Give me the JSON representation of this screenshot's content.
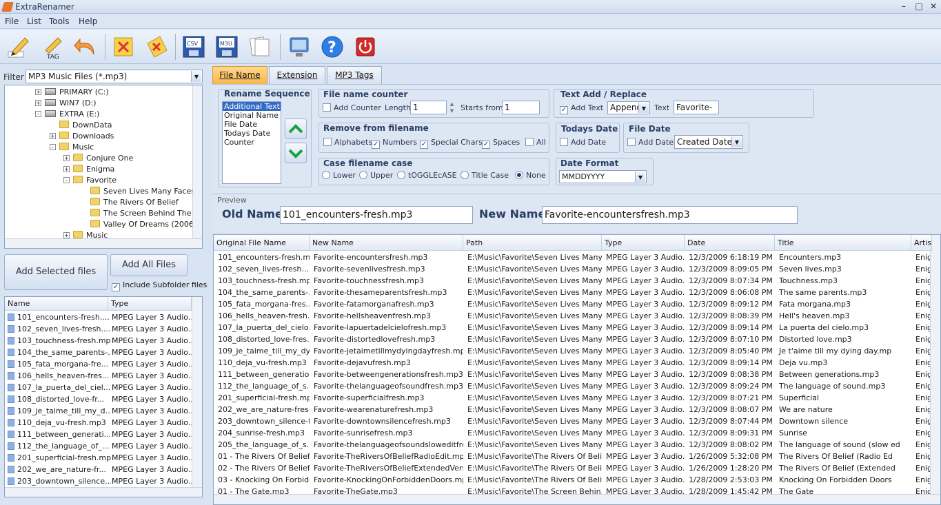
{
  "window": {
    "title": "ExtraRenamer"
  },
  "menu": [
    "File",
    "List",
    "Tools",
    "Help"
  ],
  "toolbar_icons": [
    "rename-pencil-icon",
    "tag-rename-icon",
    "undo-arrow-icon",
    "clear-selection-icon",
    "clear-all-icon",
    "csv-export-icon",
    "m3u-export-icon",
    "copy-pages-icon",
    "network-computer-icon",
    "help-icon",
    "power-icon"
  ],
  "toolbar_labels": {
    "csv": "CSV",
    "m3u": "M3U",
    "tag": "TAG"
  },
  "filter": {
    "label": "Filter",
    "value": "MP3 Music Files (*.mp3)"
  },
  "tree": [
    {
      "label": "PRIMARY (C:)",
      "indent": 0,
      "type": "drive",
      "pm": "+"
    },
    {
      "label": "WIN7 (D:)",
      "indent": 0,
      "type": "drive",
      "pm": "+"
    },
    {
      "label": "EXTRA (E:)",
      "indent": 0,
      "type": "drive",
      "pm": "-"
    },
    {
      "label": "DownData",
      "indent": 1,
      "type": "folder",
      "pm": ""
    },
    {
      "label": "Downloads",
      "indent": 1,
      "type": "folder",
      "pm": "+"
    },
    {
      "label": "Music",
      "indent": 1,
      "type": "folder",
      "pm": "-"
    },
    {
      "label": "Conjure One",
      "indent": 2,
      "type": "folder",
      "pm": "+"
    },
    {
      "label": "Enigma",
      "indent": 2,
      "type": "folder",
      "pm": "+"
    },
    {
      "label": "Favorite",
      "indent": 2,
      "type": "folder",
      "pm": "-"
    },
    {
      "label": "Seven Lives Many Faces",
      "indent": 3,
      "type": "folder",
      "pm": ""
    },
    {
      "label": "The Rivers Of Belief",
      "indent": 3,
      "type": "folder",
      "pm": ""
    },
    {
      "label": "The Screen Behind The Mirr",
      "indent": 3,
      "type": "folder",
      "pm": ""
    },
    {
      "label": "Valley Of Dreams (2006)",
      "indent": 3,
      "type": "folder",
      "pm": ""
    },
    {
      "label": "Music",
      "indent": 2,
      "type": "folder",
      "pm": "+"
    }
  ],
  "buttons": {
    "add_selected": "Add Selected files",
    "add_all": "Add All Files",
    "include_subfolder": "Include Subfolder files"
  },
  "filelist": {
    "headers": [
      "Name",
      "Type"
    ],
    "rows": [
      [
        "101_encounters-fresh....",
        "MPEG Layer 3 Audio..."
      ],
      [
        "102_seven_lives-fresh....",
        "MPEG Layer 3 Audio..."
      ],
      [
        "103_touchness-fresh.mp3",
        "MPEG Layer 3 Audio..."
      ],
      [
        "104_the_same_parents-...",
        "MPEG Layer 3 Audio..."
      ],
      [
        "105_fata_morgana-fre...",
        "MPEG Layer 3 Audio..."
      ],
      [
        "106_hells_heaven-fres...",
        "MPEG Layer 3 Audio..."
      ],
      [
        "107_la_puerta_del_ciel...",
        "MPEG Layer 3 Audio..."
      ],
      [
        "108_distorted_love-fr...",
        "MPEG Layer 3 Audio..."
      ],
      [
        "109_je_taime_till_my_d...",
        "MPEG Layer 3 Audio..."
      ],
      [
        "110_deja_vu-fresh.mp3",
        "MPEG Layer 3 Audio..."
      ],
      [
        "111_between_generati...",
        "MPEG Layer 3 Audio..."
      ],
      [
        "112_the_language_of_...",
        "MPEG Layer 3 Audio..."
      ],
      [
        "201_superficial-fresh.mp3",
        "MPEG Layer 3 Audio..."
      ],
      [
        "202_we_are_nature-fr...",
        "MPEG Layer 3 Audio..."
      ],
      [
        "203_downtown_silence...",
        "MPEG Layer 3 Audio..."
      ]
    ]
  },
  "tabs": [
    "File Name",
    "Extension",
    "MP3 Tags"
  ],
  "rename_sequence": {
    "title": "Rename Sequence",
    "items": [
      "Additional Text",
      "Original Name",
      "File Date",
      "Todays Date",
      "Counter"
    ],
    "selected": 0
  },
  "counter": {
    "title": "File name counter",
    "add_label": "Add Counter",
    "length_label": "Length",
    "length_value": "1",
    "start_label": "Starts from",
    "start_value": "1"
  },
  "text_add": {
    "title": "Text Add / Replace",
    "add_label": "Add Text",
    "mode": "Append",
    "text_label": "Text",
    "text_value": "Favorite-"
  },
  "remove": {
    "title": "Remove from filename",
    "options": [
      {
        "label": "Alphabets",
        "checked": false
      },
      {
        "label": "Numbers",
        "checked": true
      },
      {
        "label": "Special Chars.",
        "checked": true
      },
      {
        "label": "Spaces",
        "checked": true
      },
      {
        "label": "All",
        "checked": false
      }
    ]
  },
  "todays_date": {
    "title": "Todays Date",
    "add_label": "Add Date"
  },
  "file_date": {
    "title": "File Date",
    "add_label": "Add Date",
    "mode": "Created Date"
  },
  "case": {
    "title": "Case filename case",
    "options": [
      "Lower",
      "Upper",
      "tOGGLEcASE",
      "Title Case",
      "None"
    ],
    "selected": 4
  },
  "date_format": {
    "title": "Date Format",
    "value": "MMDDYYYY"
  },
  "preview": {
    "title": "Preview",
    "old_label": "Old Name",
    "old_value": "101_encounters-fresh.mp3",
    "new_label": "New Name",
    "new_value": "Favorite-encountersfresh.mp3"
  },
  "grid": {
    "headers": [
      "Original File Name",
      "New Name",
      "Path",
      "Type",
      "Date",
      "Title",
      "Artis"
    ],
    "rows": [
      [
        "101_encounters-fresh.mp3",
        "Favorite-encountersfresh.mp3",
        "E:\\Music\\Favorite\\Seven Lives Many...",
        "MPEG Layer 3 Audio...",
        "12/3/2009 6:18:19 PM",
        "Encounters.mp3",
        "Enig"
      ],
      [
        "102_seven_lives-fresh....",
        "Favorite-sevenlivesfresh.mp3",
        "E:\\Music\\Favorite\\Seven Lives Many...",
        "MPEG Layer 3 Audio...",
        "12/3/2009 8:09:05 PM",
        "Seven lives.mp3",
        "Enig"
      ],
      [
        "103_touchness-fresh.mp3",
        "Favorite-touchnessfresh.mp3",
        "E:\\Music\\Favorite\\Seven Lives Many...",
        "MPEG Layer 3 Audio...",
        "12/3/2009 8:07:34 PM",
        "Touchness.mp3",
        "Enig"
      ],
      [
        "104_the_same_parents-...",
        "Favorite-thesameparentsfresh.mp3",
        "E:\\Music\\Favorite\\Seven Lives Many...",
        "MPEG Layer 3 Audio...",
        "12/3/2009 8:06:08 PM",
        "The same parents.mp3",
        "Enig"
      ],
      [
        "105_fata_morgana-fres...",
        "Favorite-fatamorganafresh.mp3",
        "E:\\Music\\Favorite\\Seven Lives Many...",
        "MPEG Layer 3 Audio...",
        "12/3/2009 8:09:12 PM",
        "Fata morgana.mp3",
        "Enig"
      ],
      [
        "106_hells_heaven-fresh...",
        "Favorite-hellsheavenfresh.mp3",
        "E:\\Music\\Favorite\\Seven Lives Many...",
        "MPEG Layer 3 Audio...",
        "12/3/2009 8:08:39 PM",
        "Hell's heaven.mp3",
        "Enig"
      ],
      [
        "107_la_puerta_del_cielo...",
        "Favorite-lapuertadelcielofresh.mp3",
        "E:\\Music\\Favorite\\Seven Lives Many...",
        "MPEG Layer 3 Audio...",
        "12/3/2009 8:09:14 PM",
        "La puerta del cielo.mp3",
        "Enig"
      ],
      [
        "108_distorted_love-fres...",
        "Favorite-distortedlovefresh.mp3",
        "E:\\Music\\Favorite\\Seven Lives Many...",
        "MPEG Layer 3 Audio...",
        "12/3/2009 8:07:10 PM",
        "Distorted love.mp3",
        "Enig"
      ],
      [
        "109_je_taime_till_my_dy...",
        "Favorite-jetaimetillmydyingdayfresh.mp3",
        "E:\\Music\\Favorite\\Seven Lives Many...",
        "MPEG Layer 3 Audio...",
        "12/3/2009 8:05:40 PM",
        "Je t'aime till my dying day.mp",
        "Enig"
      ],
      [
        "110_deja_vu-fresh.mp3",
        "Favorite-dejavufresh.mp3",
        "E:\\Music\\Favorite\\Seven Lives Many...",
        "MPEG Layer 3 Audio...",
        "12/3/2009 8:09:14 PM",
        "Deja vu.mp3",
        "Enig"
      ],
      [
        "111_between_generatio...",
        "Favorite-betweengenerationsfresh.mp3",
        "E:\\Music\\Favorite\\Seven Lives Many...",
        "MPEG Layer 3 Audio...",
        "12/3/2009 8:08:38 PM",
        "Between generations.mp3",
        "Enig"
      ],
      [
        "112_the_language_of_s...",
        "Favorite-thelanguageofsoundfresh.mp3",
        "E:\\Music\\Favorite\\Seven Lives Many...",
        "MPEG Layer 3 Audio...",
        "12/3/2009 8:09:24 PM",
        "The language of sound.mp3",
        "Enig"
      ],
      [
        "201_superficial-fresh.mp3",
        "Favorite-superficialfresh.mp3",
        "E:\\Music\\Favorite\\Seven Lives Many...",
        "MPEG Layer 3 Audio...",
        "12/3/2009 8:07:21 PM",
        "Superficial",
        "Enig"
      ],
      [
        "202_we_are_nature-fres...",
        "Favorite-wearenaturefresh.mp3",
        "E:\\Music\\Favorite\\Seven Lives Many...",
        "MPEG Layer 3 Audio...",
        "12/3/2009 8:08:07 PM",
        "We are nature",
        "Enig"
      ],
      [
        "203_downtown_silence-f...",
        "Favorite-downtownsilencefresh.mp3",
        "E:\\Music\\Favorite\\Seven Lives Many...",
        "MPEG Layer 3 Audio...",
        "12/3/2009 8:07:44 PM",
        "Downtown silence",
        "Enig"
      ],
      [
        "204_sunrise-fresh.mp3",
        "Favorite-sunrisefresh.mp3",
        "E:\\Music\\Favorite\\Seven Lives Many...",
        "MPEG Layer 3 Audio...",
        "12/3/2009 8:09:31 PM",
        "Sunrise",
        "Enig"
      ],
      [
        "205_the_language_of_s...",
        "Favorite-thelanguageofsoundsloweditfre...",
        "E:\\Music\\Favorite\\Seven Lives Many...",
        "MPEG Layer 3 Audio...",
        "12/3/2009 8:08:02 PM",
        "The language of sound (slow ed",
        "Enig"
      ],
      [
        "01 - The Rivers Of Belief ...",
        "Favorite-TheRiversOfBeliefRadioEdit.mp3",
        "E:\\Music\\Favorite\\The Rivers Of Belief\\",
        "MPEG Layer 3 Audio...",
        "1/26/2009 5:32:08 PM",
        "The Rivers Of Belief (Radio Ed",
        "Enig"
      ],
      [
        "02 - The Rivers Of Belief ...",
        "Favorite-TheRiversOfBeliefExtendedVersi...",
        "E:\\Music\\Favorite\\The Rivers Of Belief\\",
        "MPEG Layer 3 Audio...",
        "1/26/2009 1:28:20 PM",
        "The Rivers Of Belief (Extended",
        "Enig"
      ],
      [
        "03 - Knocking On Forbidd...",
        "Favorite-KnockingOnForbiddenDoors.mp3",
        "E:\\Music\\Favorite\\The Rivers Of Belief\\",
        "MPEG Layer 3 Audio...",
        "1/28/2009 2:53:03 PM",
        "Knocking On Forbidden Doors",
        "Enig"
      ],
      [
        "01 - The Gate.mp3",
        "Favorite-TheGate.mp3",
        "E:\\Music\\Favorite\\The Screen Behin...",
        "MPEG Layer 3 Audio...",
        "1/28/2009 1:45:42 PM",
        "The Gate",
        "Enig"
      ]
    ]
  }
}
